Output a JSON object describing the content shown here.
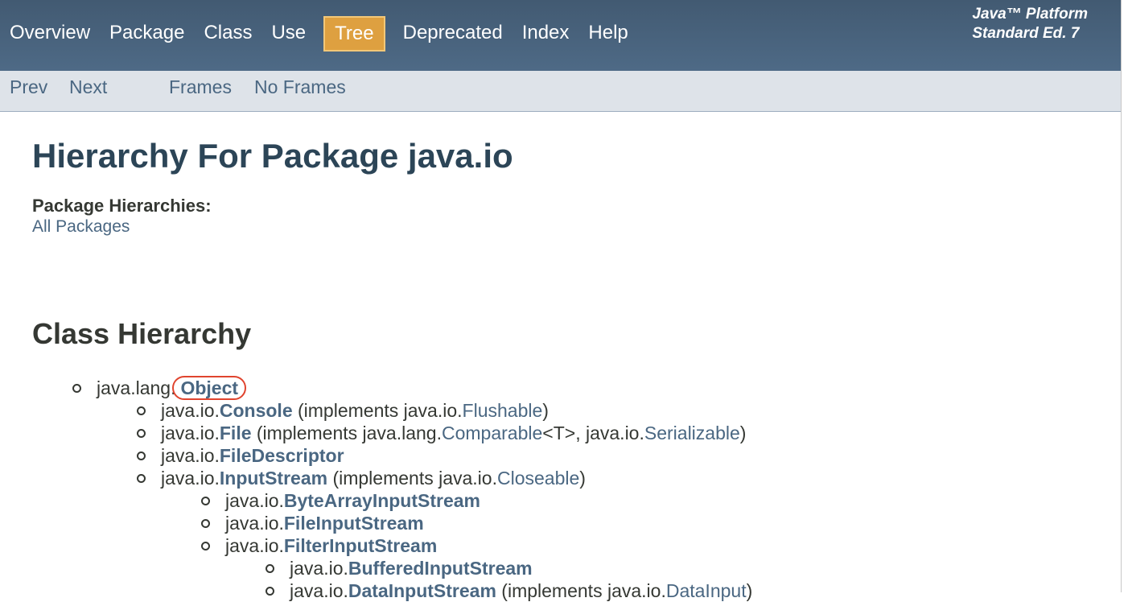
{
  "topnav": {
    "items": [
      "Overview",
      "Package",
      "Class",
      "Use",
      "Tree",
      "Deprecated",
      "Index",
      "Help"
    ],
    "active": "Tree",
    "brand_line1": "Java™ Platform",
    "brand_line2": "Standard Ed. 7"
  },
  "subnav": {
    "prev": "Prev",
    "next": "Next",
    "frames": "Frames",
    "no_frames": "No Frames"
  },
  "header": {
    "title": "Hierarchy For Package java.io",
    "package_hierarchies_label": "Package Hierarchies:",
    "all_packages": "All Packages"
  },
  "class_hierarchy": {
    "heading": "Class Hierarchy",
    "rows": [
      {
        "prefix": "java.lang.",
        "name": "Object",
        "suffix": "",
        "highlighted": true
      },
      {
        "prefix": "java.io.",
        "name": "Console",
        "suffix_pre": " (implements java.io.",
        "iface1": "Flushable",
        "suffix_post": ")"
      },
      {
        "prefix": "java.io.",
        "name": "File",
        "suffix_pre": " (implements java.lang.",
        "iface1": "Comparable",
        "mid": "<T>, java.io.",
        "iface2": "Serializable",
        "suffix_post": ")"
      },
      {
        "prefix": "java.io.",
        "name": "FileDescriptor"
      },
      {
        "prefix": "java.io.",
        "name": "InputStream",
        "suffix_pre": " (implements java.io.",
        "iface1": "Closeable",
        "suffix_post": ")"
      },
      {
        "prefix": "java.io.",
        "name": "ByteArrayInputStream"
      },
      {
        "prefix": "java.io.",
        "name": "FileInputStream"
      },
      {
        "prefix": "java.io.",
        "name": "FilterInputStream"
      },
      {
        "prefix": "java.io.",
        "name": "BufferedInputStream"
      },
      {
        "prefix": "java.io.",
        "name": "DataInputStream",
        "suffix_pre": " (implements java.io.",
        "iface1": "DataInput",
        "suffix_post": ")"
      }
    ]
  }
}
